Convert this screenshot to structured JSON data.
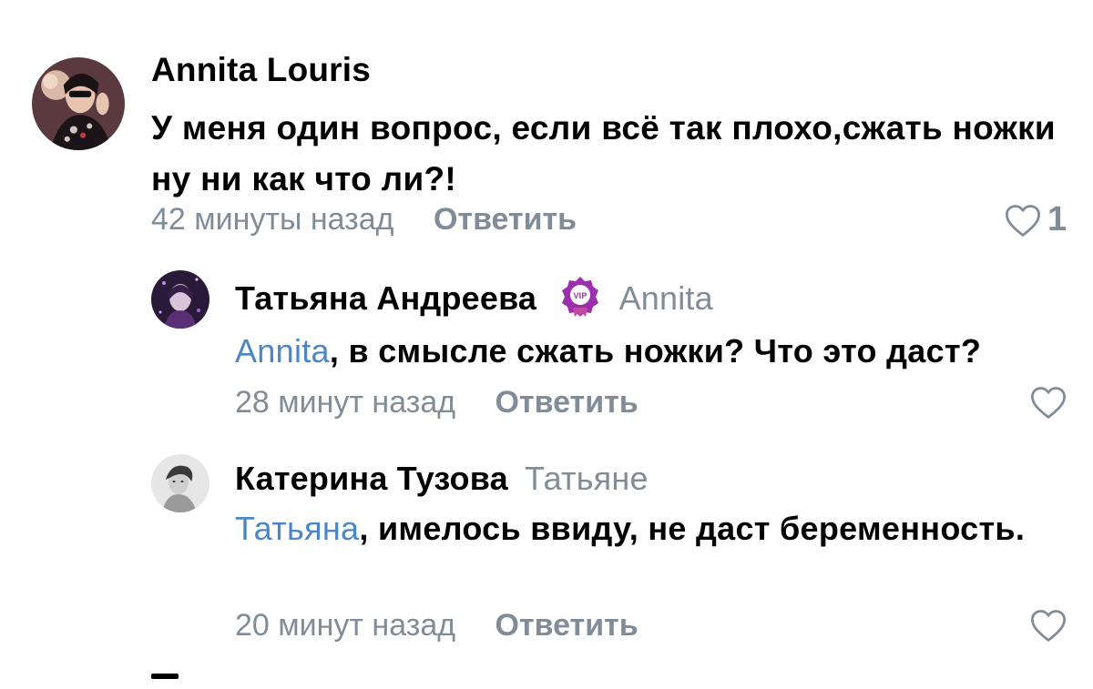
{
  "comments": [
    {
      "author": "Annita Louris",
      "reply_to": "",
      "mention": "",
      "text": "У меня один вопрос, если всё так плохо,сжать ножки ну ни как что ли?!",
      "time": "42 минуты назад",
      "reply_label": "Ответить",
      "likes": "1"
    },
    {
      "author": "Татьяна Андреева",
      "badge": "VIP",
      "reply_to": "Annita",
      "mention": "Annita",
      "text": ", в смысле сжать ножки? Что это даст?",
      "time": "28 минут назад",
      "reply_label": "Ответить",
      "likes": ""
    },
    {
      "author": "Катерина Тузова",
      "reply_to": "Татьяне",
      "mention": "Татьяна",
      "text": ", имелось ввиду, не даст беременность.",
      "time": "20 минут назад",
      "reply_label": "Ответить",
      "likes": ""
    }
  ],
  "colors": {
    "secondary_text": "#818c99",
    "mention": "#4a86c8",
    "vip_badge": "#9b2fae"
  },
  "icons": [
    "heart-outline-icon",
    "vip-badge-icon"
  ]
}
